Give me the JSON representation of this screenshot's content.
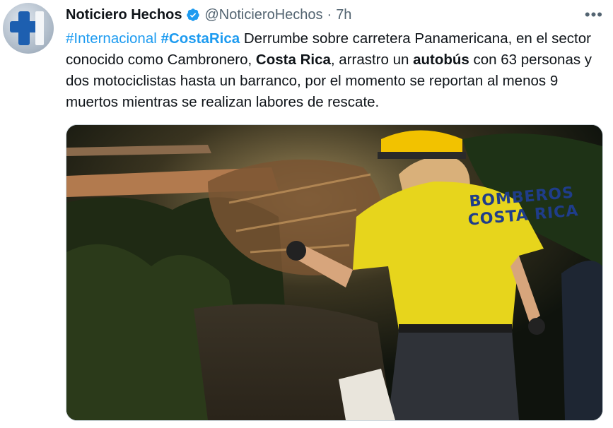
{
  "tweet": {
    "author_name": "Noticiero Hechos",
    "handle": "@NoticieroHechos",
    "separator": "·",
    "time": "7h",
    "more_label": "•••",
    "text": {
      "hashtag1": "#Internacional",
      "hashtag2": "#CostaRica",
      "part1": " Derrumbe sobre carretera Panamericana, en el sector conocido como Cambronero, ",
      "bold1": "Costa Rica",
      "part2": ", arrastro un ",
      "bold2": "autobús",
      "part3": " con 63 personas y dos motociclistas hasta un barranco, por el momento se reportan al menos 9 muertos mientras se realizan labores de rescate."
    }
  },
  "media": {
    "shirt_line1": "BOMBEROS",
    "shirt_line2": "COSTA RICA"
  },
  "colors": {
    "link": "#1d9bf0",
    "secondary": "#536471",
    "shirt": "#e7d51c",
    "helmet": "#f2c200"
  },
  "icons": {
    "verified": "verified-badge-icon",
    "more": "more-options-icon"
  }
}
